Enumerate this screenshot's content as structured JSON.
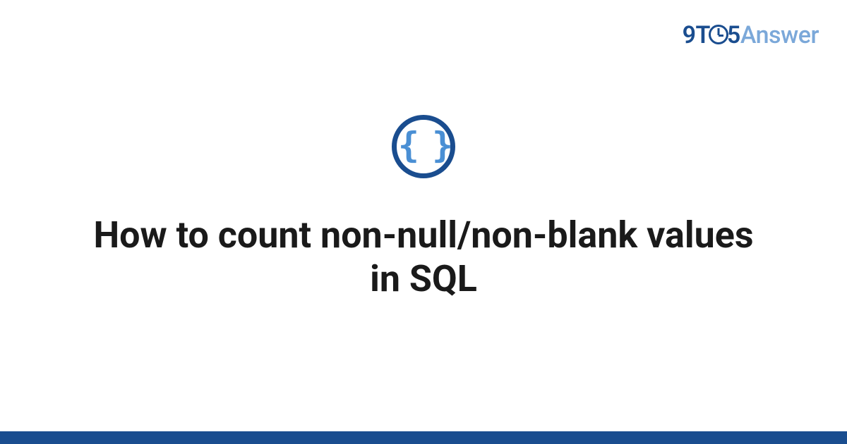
{
  "logo": {
    "part1": "9T",
    "part2": "5",
    "part3": "Answer"
  },
  "icon": {
    "name": "code-braces-icon",
    "glyph": "{ }"
  },
  "title": "How to count non-null/non-blank values in SQL",
  "colors": {
    "primary": "#1a4d8f",
    "accent": "#4a8fd4",
    "light": "#7ba8d9"
  }
}
